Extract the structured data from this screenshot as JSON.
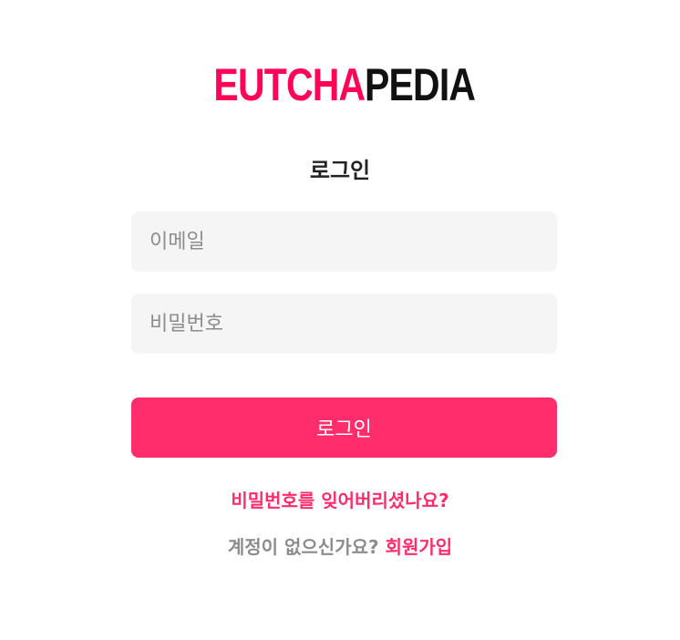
{
  "brand": {
    "part1": "EUTCHA",
    "part2": "PEDIA",
    "accent_color": "#ff0558",
    "dark_color": "#111111"
  },
  "title": "로그인",
  "form": {
    "email": {
      "value": "",
      "placeholder": "이메일"
    },
    "password": {
      "value": "",
      "placeholder": "비밀번호"
    },
    "submit_label": "로그인",
    "button_color": "#ff2d6c"
  },
  "links": {
    "forgot_password": "비밀번호를 잊어버리셨나요?",
    "no_account_prompt": "계정이 없으신가요?",
    "signup": "회원가입"
  }
}
